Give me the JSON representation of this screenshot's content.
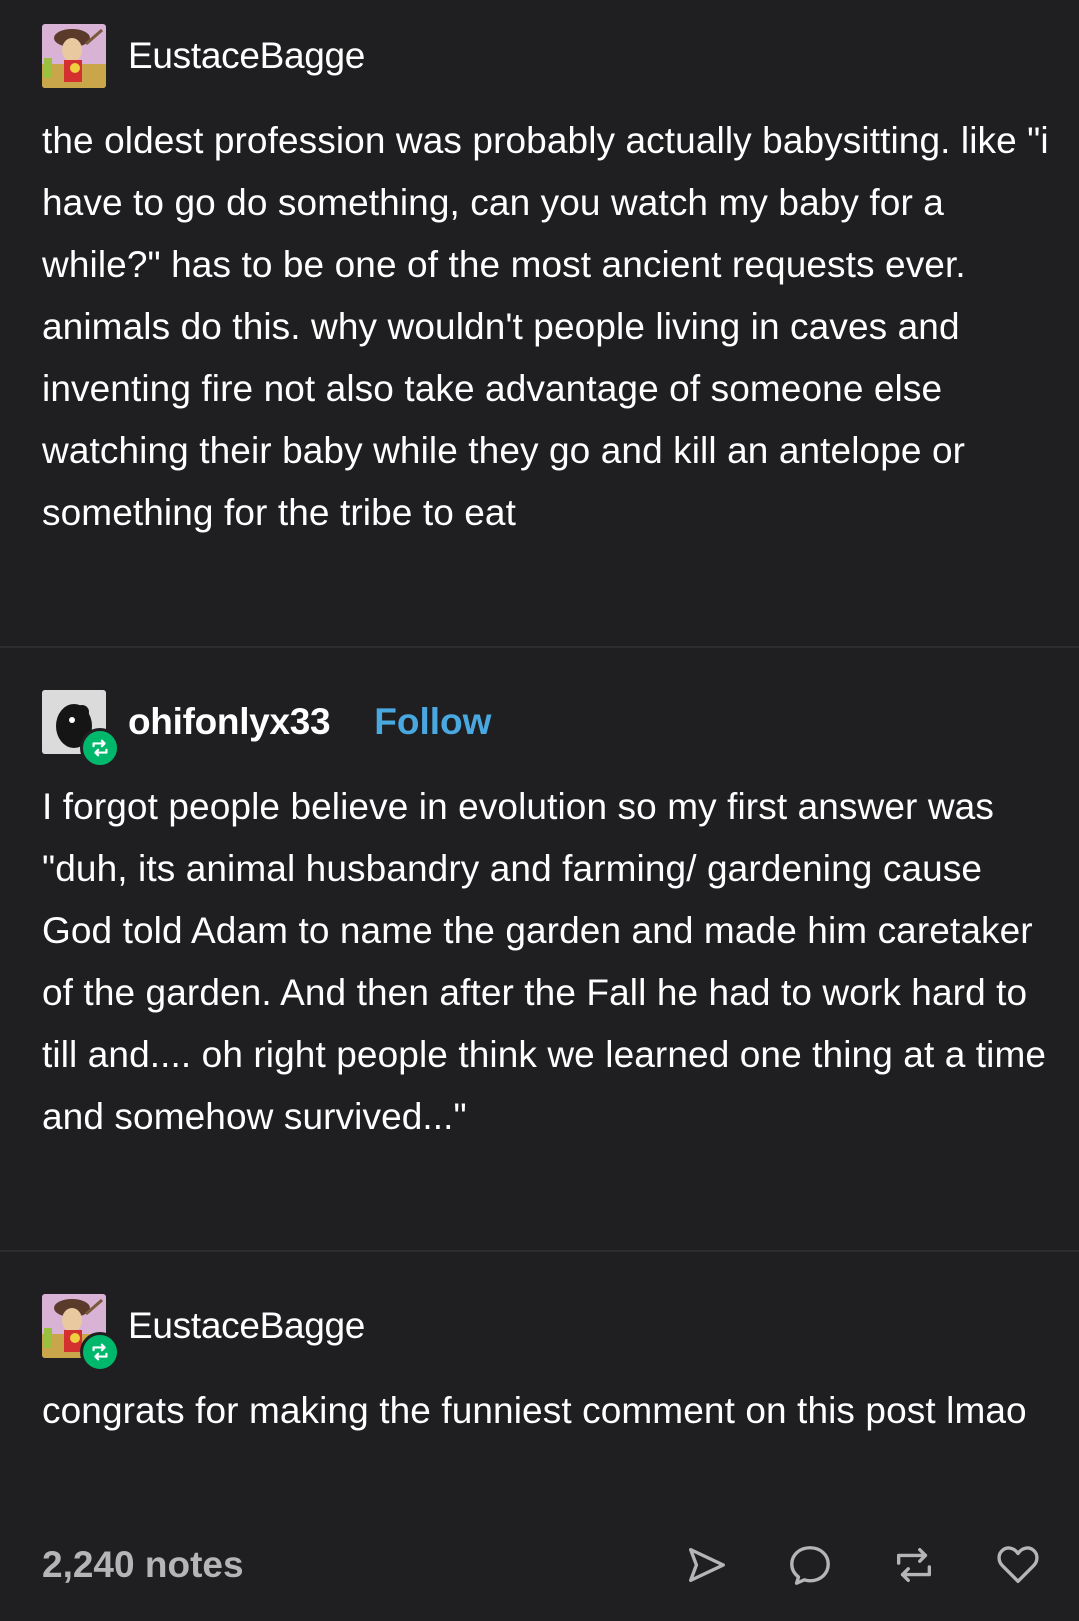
{
  "posts": [
    {
      "username": "EustaceBagge",
      "avatar": "cartoon-character-avatar",
      "is_reblog": false,
      "text": "the oldest profession was probably actually babysitting. like \"i have to go do something, can you watch my baby for a while?\" has to be one of the most ancient requests ever. animals do this. why wouldn't people living in caves and inventing fire not also take advantage of someone else watching their baby while they go and kill an antelope or something for the tribe to eat"
    },
    {
      "username": "ohifonlyx33",
      "avatar": "dark-silhouette-avatar",
      "is_reblog": true,
      "follow_label": "Follow",
      "text": "I forgot people believe in evolution so my first answer was \"duh, its animal husbandry and farming/ gardening cause  God told Adam to name the garden and made him caretaker of the garden. And then after the Fall he had to work hard to till and.... oh right people think we learned one thing at a time and somehow survived...\""
    },
    {
      "username": "EustaceBagge",
      "avatar": "cartoon-character-avatar",
      "is_reblog": true,
      "text": "congrats for making the funniest comment on this post lmao"
    }
  ],
  "footer": {
    "notes": "2,240 notes",
    "actions": [
      "share-icon",
      "reply-icon",
      "reblog-icon",
      "like-icon"
    ]
  },
  "colors": {
    "background": "#1f1f21",
    "text": "#ffffff",
    "follow": "#4aa8e0",
    "reblog_badge": "#00b86b",
    "notes": "#b5b5b8"
  }
}
